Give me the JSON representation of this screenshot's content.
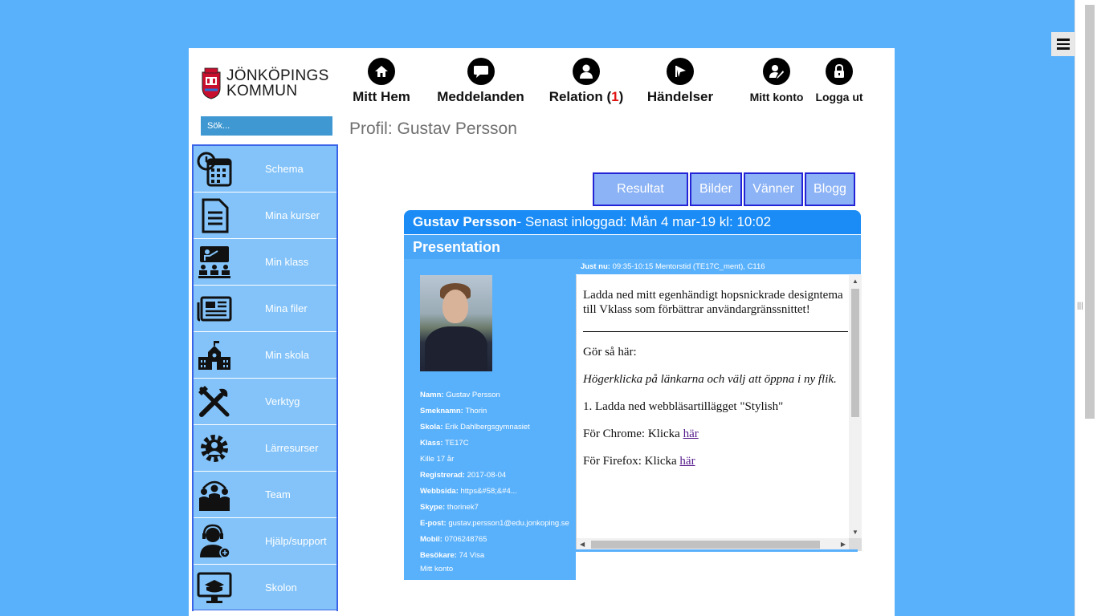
{
  "header": {
    "logo_line1": "JÖNKÖPINGS",
    "logo_line2": "KOMMUN",
    "search_placeholder": "Sök..."
  },
  "topnav": {
    "home": "Mitt Hem",
    "messages": "Meddelanden",
    "relation": "Relation (",
    "relation_count": "1",
    "relation_close": ")",
    "events": "Händelser",
    "account": "Mitt konto",
    "logout": "Logga ut"
  },
  "sidebar": {
    "items": [
      {
        "label": "Schema",
        "icon": "calendar-clock-icon"
      },
      {
        "label": "Mina kurser",
        "icon": "document-icon"
      },
      {
        "label": "Min klass",
        "icon": "classroom-icon"
      },
      {
        "label": "Mina filer",
        "icon": "newspaper-icon"
      },
      {
        "label": "Min skola",
        "icon": "school-building-icon"
      },
      {
        "label": "Verktyg",
        "icon": "tools-icon"
      },
      {
        "label": "Lärresurser",
        "icon": "gear-person-icon"
      },
      {
        "label": "Team",
        "icon": "team-icon"
      },
      {
        "label": "Hjälp/support",
        "icon": "headset-support-icon"
      },
      {
        "label": "Skolon",
        "icon": "monitor-book-icon"
      }
    ]
  },
  "profile": {
    "title": "Profil: Gustav Persson",
    "tabs": [
      "Resultat",
      "Bilder",
      "Vänner",
      "Blogg"
    ],
    "name": "Gustav Persson",
    "last_login": " - Senast inloggad: Mån 4 mar-19 kl: 10:02",
    "presentation": "Presentation",
    "just_now_label": "Just nu:",
    "just_now_value": " 09:35-10:15 Mentorstid (TE17C_ment), C116"
  },
  "info": {
    "namn_label": "Namn:",
    "namn": " Gustav Persson",
    "smeknamn_label": "Smeknamn:",
    "smeknamn": " Thorin",
    "skola_label": "Skola:",
    "skola": " Erik Dahlbergsgymnasiet",
    "klass_label": "Klass:",
    "klass": " TE17C",
    "kon_alder": "Kille 17 år",
    "registrerad_label": "Registrerad:",
    "registrerad": " 2017-08-04",
    "webbsida_label": "Webbsida:",
    "webbsida": " https&#58;&#4...",
    "skype_label": "Skype:",
    "skype": " thorinek7",
    "epost_label": "E-post:",
    "epost": " gustav.persson1@edu.jonkoping.se",
    "mobil_label": "Mobil:",
    "mobil": " 0706248765",
    "besokare_label": "Besökare:",
    "besokare": " 74 Visa",
    "mitt_konto": "Mitt konto"
  },
  "presentation_text": {
    "p1": "Ladda ned mitt egenhändigt hopsnickrade designtema till Vklass som förbättrar användargränssnittet!",
    "p2": "Gör så här:",
    "p3": "Högerklicka på länkarna och välj att öppna i ny flik.",
    "p4": "1. Ladda ned webbläsartillägget \"Stylish\"",
    "p5_prefix": "För Chrome: Klicka ",
    "p5_link": "här",
    "p6_prefix": "För Firefox: Klicka ",
    "p6_link": "här"
  }
}
